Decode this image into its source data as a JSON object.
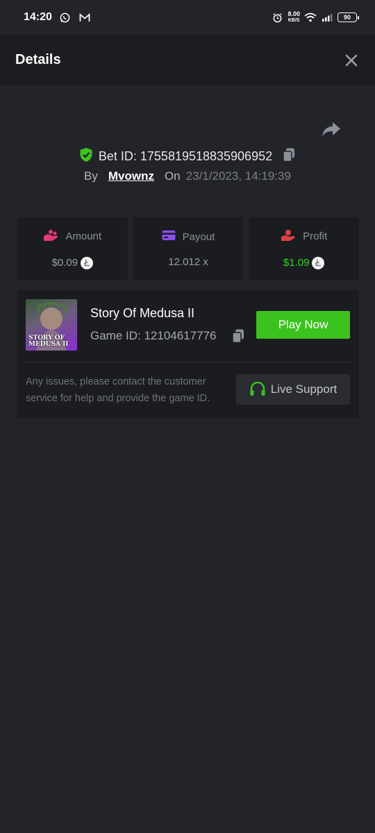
{
  "status_bar": {
    "time": "14:20",
    "net_speed_value": "8.00",
    "net_speed_unit": "KB/S",
    "battery": "90"
  },
  "header": {
    "title": "Details"
  },
  "bet": {
    "id_label": "Bet ID: 1755819518835906952",
    "by_label": "By",
    "username": "Mvownz",
    "on_label": "On",
    "date": "23/1/2023, 14:19:39"
  },
  "stats": [
    {
      "label": "Amount",
      "value": "$0.09",
      "icon": "coins-hand-icon",
      "color": "#e23a78"
    },
    {
      "label": "Payout",
      "value": "12.012 x",
      "icon": "card-icon",
      "color": "#8a4ff0"
    },
    {
      "label": "Profit",
      "value": "$1.09",
      "icon": "profit-hand-icon",
      "color": "#e0413f"
    }
  ],
  "game": {
    "title": "Story Of Medusa II",
    "id_label": "Game ID: 12104617776",
    "thumb_text_line1": "STORY OF",
    "thumb_text_line2": "MEDUSA II",
    "play_label": "Play Now"
  },
  "support": {
    "text": "Any issues, please contact the customer service for help and provide the game ID.",
    "button_label": "Live Support"
  },
  "colors": {
    "accent_green": "#3cc21f",
    "background": "#232429",
    "card": "#1b1c20"
  }
}
